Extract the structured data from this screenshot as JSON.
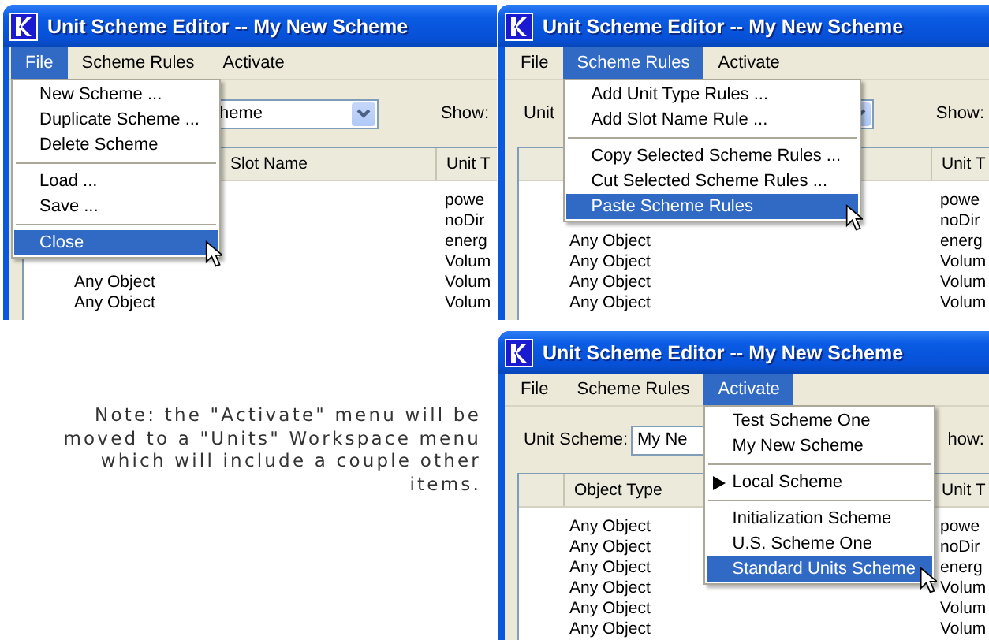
{
  "windows": [
    {
      "title": "Unit Scheme Editor -- My New Scheme",
      "menubar": [
        {
          "label": "File",
          "selected": true
        },
        {
          "label": "Scheme Rules",
          "selected": false
        },
        {
          "label": "Activate",
          "selected": false
        }
      ],
      "menu": [
        {
          "kind": "item",
          "label": "New Scheme ...",
          "selected": false
        },
        {
          "kind": "item",
          "label": "Duplicate Scheme ...",
          "selected": false
        },
        {
          "kind": "item",
          "label": "Delete Scheme",
          "selected": false
        },
        {
          "kind": "separator"
        },
        {
          "kind": "item",
          "label": "Load ...",
          "selected": false
        },
        {
          "kind": "item",
          "label": "Save ...",
          "selected": false
        },
        {
          "kind": "separator"
        },
        {
          "kind": "item",
          "label": "Close",
          "selected": true
        }
      ],
      "toolbar": {
        "scheme_value": "heme",
        "show_label": "Show:"
      },
      "table": {
        "headers": {
          "slot_name": "Slot Name",
          "unit_type": "Unit T"
        },
        "rows": [
          {
            "unit_type": "powe"
          },
          {
            "unit_type": "noDir"
          },
          {
            "unit_type": "energ"
          },
          {
            "unit_type": "Volum"
          },
          {
            "object_type": "Any Object",
            "unit_type": "Volum"
          },
          {
            "object_type": "Any Object",
            "unit_type": "Volum"
          }
        ]
      }
    },
    {
      "title": "Unit Scheme Editor -- My New Scheme",
      "menubar": [
        {
          "label": "File",
          "selected": false
        },
        {
          "label": "Scheme Rules",
          "selected": true
        },
        {
          "label": "Activate",
          "selected": false
        }
      ],
      "menu": [
        {
          "kind": "item",
          "label": "Add Unit Type Rules ...",
          "selected": false
        },
        {
          "kind": "item",
          "label": "Add Slot Name Rule ...",
          "selected": false
        },
        {
          "kind": "separator"
        },
        {
          "kind": "item",
          "label": "Copy Selected Scheme Rules ...",
          "selected": false
        },
        {
          "kind": "item",
          "label": "Cut Selected Scheme Rules ...",
          "selected": false
        },
        {
          "kind": "item",
          "label": "Paste Scheme Rules",
          "selected": true
        }
      ],
      "toolbar": {
        "scheme_label": "Unit",
        "show_label": "Show:"
      },
      "table": {
        "headers": {
          "unit_type": "Unit T"
        },
        "rows": [
          {
            "unit_type": "powe"
          },
          {
            "unit_type": "noDir"
          },
          {
            "object_type": "Any Object",
            "unit_type": "energ"
          },
          {
            "object_type": "Any Object",
            "unit_type": "Volum"
          },
          {
            "object_type": "Any Object",
            "unit_type": "Volum"
          },
          {
            "object_type": "Any Object",
            "unit_type": "Volum"
          }
        ]
      }
    },
    {
      "title": "Unit Scheme Editor -- My New Scheme",
      "menubar": [
        {
          "label": "File",
          "selected": false
        },
        {
          "label": "Scheme Rules",
          "selected": false
        },
        {
          "label": "Activate",
          "selected": true
        }
      ],
      "menu": [
        {
          "kind": "item",
          "label": "Test Scheme One",
          "selected": false,
          "current": false
        },
        {
          "kind": "item",
          "label": "My New Scheme",
          "selected": false,
          "current": false
        },
        {
          "kind": "separator"
        },
        {
          "kind": "item",
          "label": "Local Scheme",
          "selected": false,
          "current": true
        },
        {
          "kind": "separator"
        },
        {
          "kind": "item",
          "label": "Initialization Scheme",
          "selected": false,
          "current": false
        },
        {
          "kind": "item",
          "label": "U.S. Scheme One",
          "selected": false,
          "current": false
        },
        {
          "kind": "item",
          "label": "Standard Units Scheme",
          "selected": true,
          "current": false
        }
      ],
      "toolbar": {
        "scheme_label": "Unit Scheme:",
        "scheme_value": "My Ne",
        "show_label": "how:"
      },
      "table": {
        "headers": {
          "object_type": "Object Type",
          "unit_type": "Unit T"
        },
        "rows": [
          {
            "object_type": "Any Object",
            "unit_type": "powe"
          },
          {
            "object_type": "Any Object",
            "unit_type": "noDir"
          },
          {
            "object_type": "Any Object",
            "unit_type": "energ"
          },
          {
            "object_type": "Any Object",
            "unit_type": "Volum"
          },
          {
            "object_type": "Any Object",
            "unit_type": "Volum"
          },
          {
            "object_type": "Any Object",
            "unit_type": "Volum"
          }
        ]
      }
    }
  ],
  "note": "Note: the \"Activate\" menu will be moved to a \"Units\" Workspace menu which will include a couple other items."
}
